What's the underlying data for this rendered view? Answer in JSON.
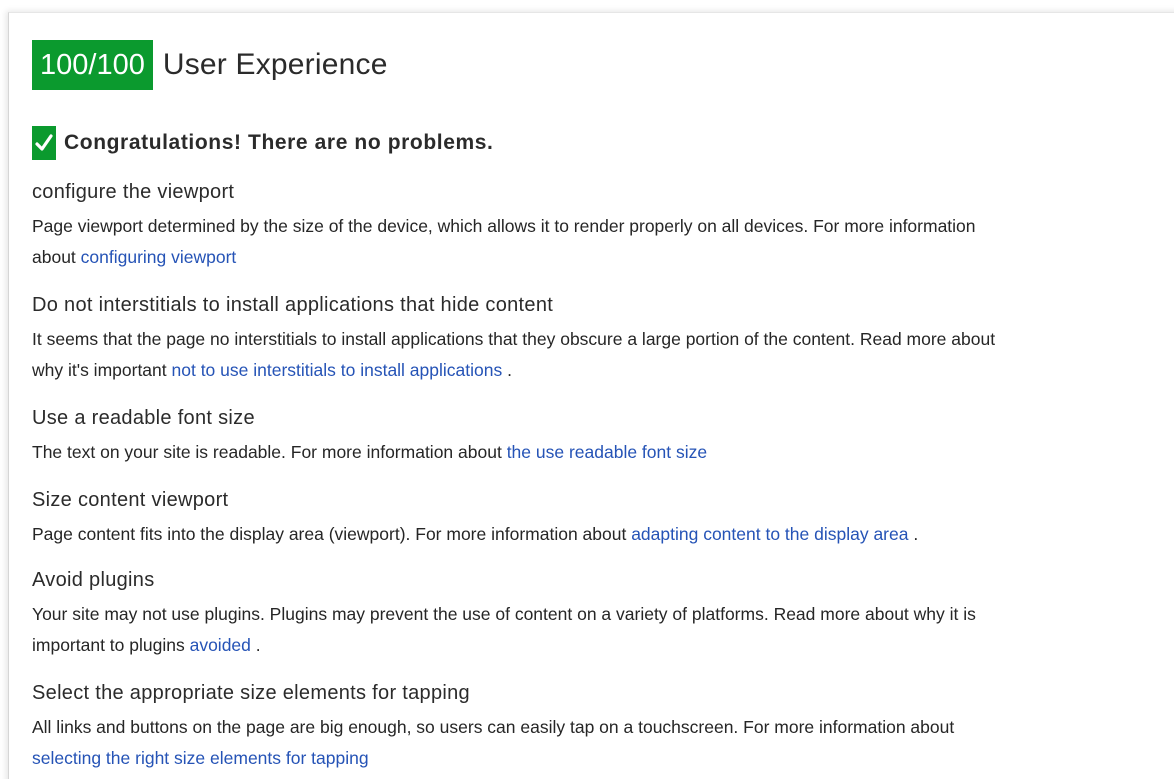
{
  "header": {
    "score": "100/100",
    "title": "User Experience"
  },
  "summary": {
    "message": "Congratulations! There are no problems."
  },
  "rules": [
    {
      "title": "configure the viewport",
      "line1": "Page viewport determined by the size of the device, which allows it to render properly on all devices. For more information",
      "line2_prefix": "about ",
      "link": "configuring viewport",
      "suffix": ""
    },
    {
      "title": "Do not interstitials to install applications that hide content",
      "line1": "It seems that the page no interstitials to install applications that they obscure a large portion of the content. Read more about",
      "line2_prefix": "why it's important ",
      "link": "not to use interstitials to install applications",
      "suffix": " ."
    },
    {
      "title": "Use a readable font size",
      "line1_prefix": "The text on your site is readable. For more information about ",
      "link": "the use readable font size",
      "suffix": ""
    },
    {
      "title": "Size content viewport",
      "line1_prefix": "Page content fits into the display area (viewport). For more information about ",
      "link": "adapting content to the display area",
      "suffix": " ."
    },
    {
      "title": "Avoid plugins",
      "line1": "Your site may not use plugins. Plugins may prevent the use of content on a variety of platforms. Read more about why it is",
      "line2_prefix": "important to plugins ",
      "link": "avoided",
      "suffix": " ."
    },
    {
      "title": "Select the appropriate size elements for tapping",
      "line1": "All links and buttons on the page are big enough, so users can easily tap on a touchscreen. For more information about",
      "line2_prefix": "",
      "link": "selecting the right size elements for tapping",
      "suffix": ""
    }
  ],
  "colors": {
    "accent_green": "#0b9a2e",
    "link_blue": "#2553b6"
  },
  "icons": {
    "check": "check-icon"
  }
}
